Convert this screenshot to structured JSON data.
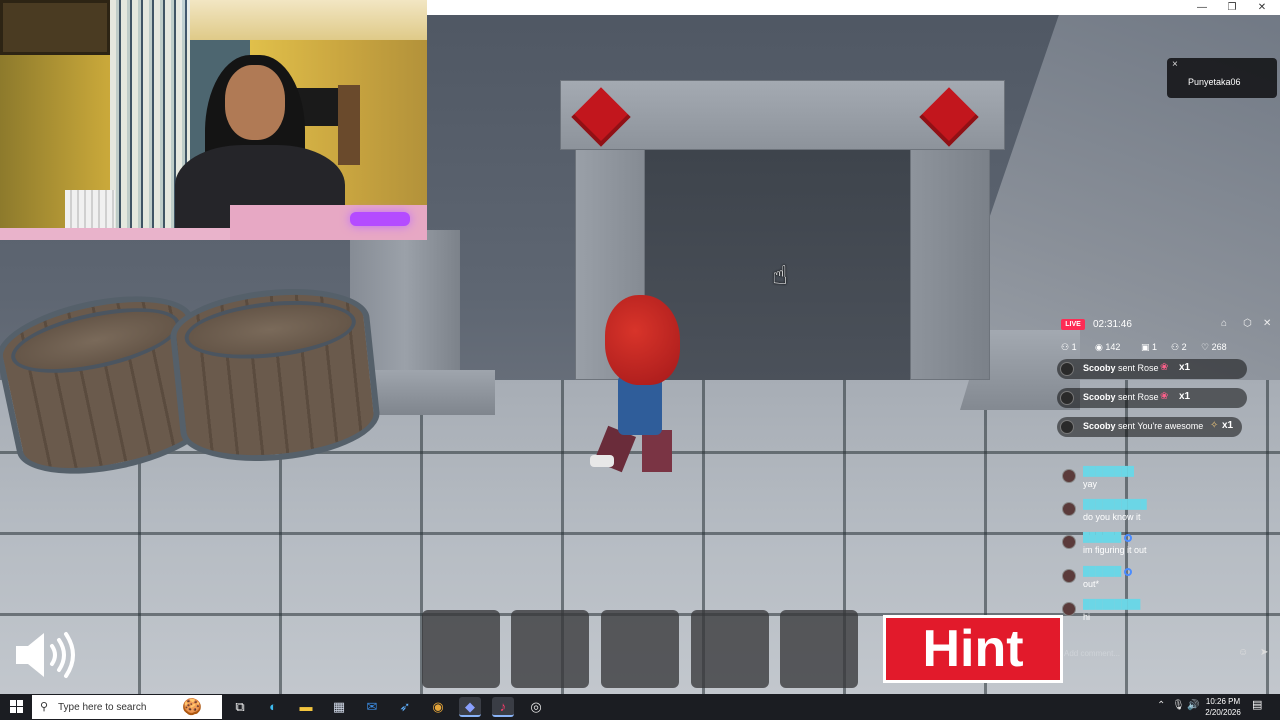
{
  "taskbar": {
    "search_placeholder": "Type here to search",
    "clock_time": "10:26 PM",
    "clock_date": "2/20/2026",
    "apps": [
      {
        "name": "task-view",
        "glyph": "⧉"
      },
      {
        "name": "edge",
        "glyph": "◐"
      },
      {
        "name": "file-explorer",
        "glyph": "▬"
      },
      {
        "name": "store",
        "glyph": "▦"
      },
      {
        "name": "outlook",
        "glyph": "✉"
      },
      {
        "name": "pin-app",
        "glyph": "➶"
      },
      {
        "name": "chrome",
        "glyph": "◉"
      },
      {
        "name": "roblox",
        "glyph": "◆"
      },
      {
        "name": "tiktok",
        "glyph": "♪"
      },
      {
        "name": "obs",
        "glyph": "◎"
      }
    ]
  },
  "user_popup": {
    "close_label": "×",
    "username": "Punyetaka06"
  },
  "live": {
    "badge": "LIVE",
    "duration": "02:31:46",
    "stats": {
      "a": "1",
      "viewers": "142",
      "gifts": "1",
      "shares": "2",
      "likes": "268"
    },
    "gifts": [
      {
        "user": "Scooby",
        "text": " sent Rose ",
        "mult": "x1"
      },
      {
        "user": "Scooby",
        "text": " sent Rose ",
        "mult": "x1"
      },
      {
        "user": "Scooby",
        "text": " sent You're awesome ",
        "mult": "x1"
      }
    ],
    "chat": [
      {
        "msg": "yay"
      },
      {
        "msg": "do you know it"
      },
      {
        "msg": "im figuring it out"
      },
      {
        "msg": "out*"
      },
      {
        "msg": "hi"
      }
    ],
    "comment_placeholder": "Add comment..."
  },
  "game": {
    "hint_label": "Hint",
    "hotbar_slots": 5
  },
  "colors": {
    "hint_red": "#e21a2b",
    "live_pink": "#fe2c55",
    "taskbar": "#1b1d22"
  }
}
